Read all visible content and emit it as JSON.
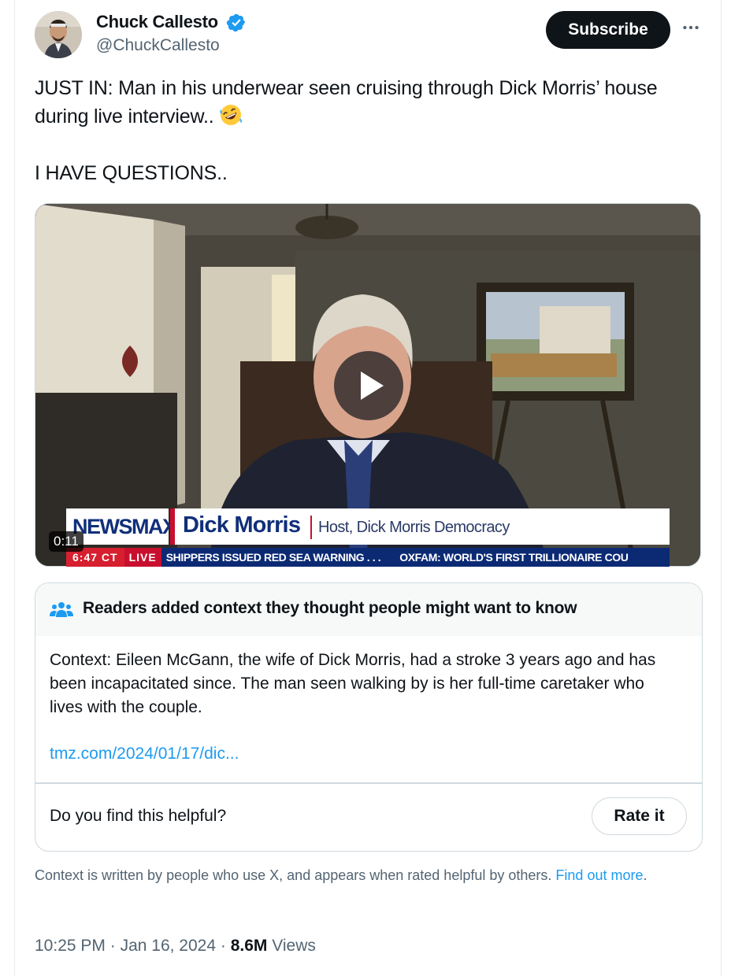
{
  "author": {
    "name": "Chuck Callesto",
    "handle": "@ChuckCallesto",
    "verified": true,
    "verified_color": "#1d9bf0"
  },
  "actions": {
    "subscribe_label": "Subscribe",
    "more_icon": "more-horizontal-icon"
  },
  "tweet": {
    "line1": "JUST IN: Man in his underwear seen cruising through Dick Morris’ house during live interview..",
    "emoji": "rolling-on-floor-laughing",
    "line2": "I HAVE QUESTIONS.."
  },
  "video": {
    "duration": "0:11",
    "play_icon": "play-icon",
    "overlay": {
      "channel": "NEWSMAX",
      "guest_name": "Dick Morris",
      "guest_title": "Host, Dick Morris Democracy",
      "time": "6:47 CT",
      "live": "LIVE",
      "headline1": "SHIPPERS ISSUED RED SEA WARNING . . .",
      "headline2": "OXFAM: WORLD'S FIRST TRILLIONAIRE COU"
    }
  },
  "community_note": {
    "header": "Readers added context they thought people might want to know",
    "body": "Context: Eileen McGann, the wife of Dick Morris, had a stroke 3 years ago and has been incapacitated since. The man seen walking by is her full-time caretaker who lives with the couple.",
    "link": "tmz.com/2024/01/17/dic...",
    "question": "Do you find this helpful?",
    "rate_label": "Rate it",
    "disclaimer": "Context is written by people who use X, and appears when rated helpful by others.",
    "find_out_more": "Find out more",
    "disclaimer_end": "."
  },
  "meta": {
    "time": "10:25 PM",
    "sep": "·",
    "date": "Jan 16, 2024",
    "views_count": "8.6M",
    "views_label": "Views"
  },
  "colors": {
    "accent": "#1d9bf0",
    "text": "#0f1419",
    "muted": "#536471",
    "newsmax_blue": "#102f7a",
    "newsmax_red": "#c8102e"
  }
}
